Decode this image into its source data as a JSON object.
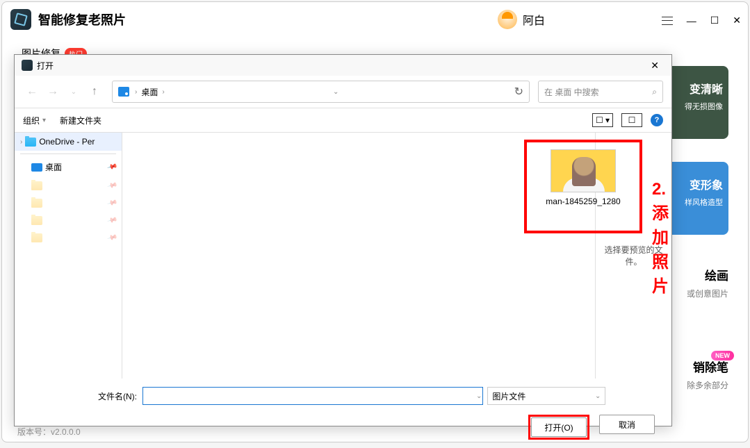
{
  "main_app": {
    "title": "智能修复老照片",
    "user_name": "阿白",
    "tab_label": "图片修复",
    "hot_badge": "热门",
    "version": "版本号：v2.0.0.0",
    "card_green_line1": "变清晰",
    "card_green_line2": "得无损图像",
    "card_blue_line1": "变形象",
    "card_blue_line2": "样风格造型",
    "card_purple_line1": "绘画",
    "card_purple_line2": "或创意图片",
    "card_erase_line1": "销除笔",
    "card_erase_line2": "除多余部分",
    "new_badge": "NEW"
  },
  "dialog": {
    "title": "打开",
    "breadcrumb_item": "桌面",
    "search_placeholder": "在 桌面 中搜索",
    "organize_label": "组织",
    "new_folder_label": "新建文件夹",
    "tree": {
      "onedrive": "OneDrive - Per",
      "desktop": "桌面"
    },
    "file_name": "man-1845259_1280",
    "preview_text": "选择要预览的文件。",
    "filename_label": "文件名(N):",
    "filetype_label": "图片文件",
    "open_button": "打开(O)",
    "cancel_button": "取消"
  },
  "annotation": "2.添加照片"
}
